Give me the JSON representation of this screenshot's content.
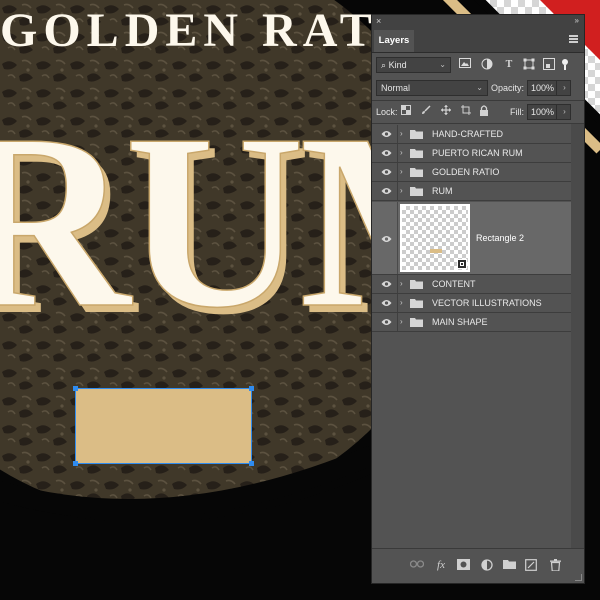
{
  "canvas": {
    "artwork_text": {
      "arc": "GOLDEN RATIO",
      "main": "RUM"
    },
    "selected_shape": "Rectangle 2",
    "colors": {
      "black": "#060606",
      "gold": "#dbbd86",
      "cream": "#fdf8ec",
      "red": "#d11f1f",
      "selection": "#2f8cf0"
    }
  },
  "panel": {
    "close_icon": "×",
    "collapse_icon": "»",
    "tab": "Layers",
    "menu_icon": "hamburger-icon",
    "filter": {
      "kind_label": "Kind",
      "kind_chev": "⌄",
      "icons": [
        "image-icon",
        "adjustment-icon",
        "type-icon",
        "shape-icon",
        "smart-object-icon"
      ]
    },
    "blend_mode": "Normal",
    "blend_chev": "⌄",
    "opacity_label": "Opacity:",
    "opacity_value": "100%",
    "arrow": "›",
    "lock_label": "Lock:",
    "fill_label": "Fill:",
    "fill_value": "100%",
    "layers": [
      {
        "name": "HAND-CRAFTED",
        "type": "group"
      },
      {
        "name": "PUERTO RICAN RUM",
        "type": "group"
      },
      {
        "name": "GOLDEN RATIO",
        "type": "group"
      },
      {
        "name": "RUM",
        "type": "group"
      },
      {
        "name": "Rectangle 2",
        "type": "shape",
        "selected": true
      },
      {
        "name": "CONTENT",
        "type": "group"
      },
      {
        "name": "VECTOR ILLUSTRATIONS",
        "type": "group"
      },
      {
        "name": "MAIN SHAPE",
        "type": "group"
      }
    ],
    "caret": "›",
    "bottom_icons": [
      "link-icon",
      "fx-icon",
      "mask-icon",
      "adjustment-layer-icon",
      "new-group-icon",
      "new-layer-icon",
      "delete-icon"
    ],
    "fx_label": "fx"
  }
}
